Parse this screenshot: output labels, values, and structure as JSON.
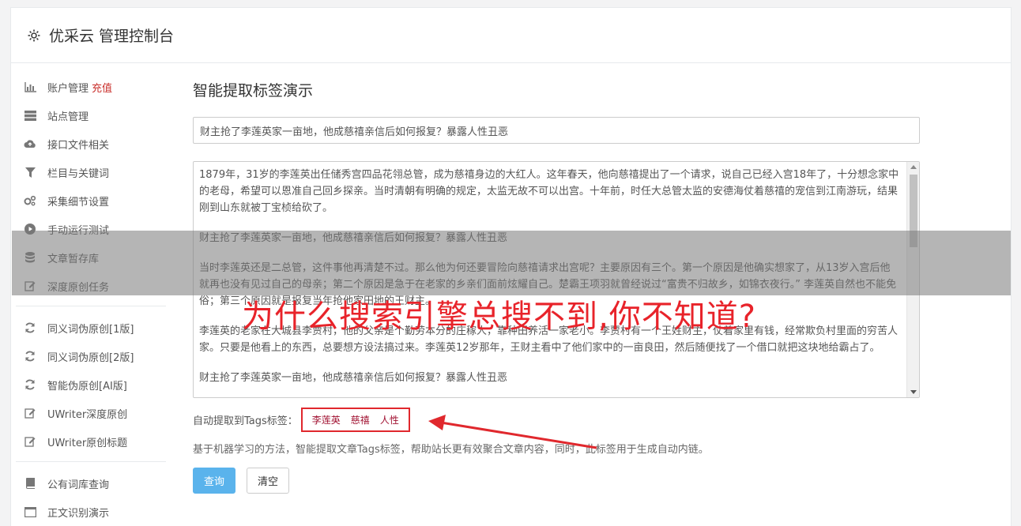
{
  "header": {
    "icon": "gear-icon",
    "title": "优采云 管理控制台"
  },
  "sidebar": {
    "groups": [
      [
        {
          "icon": "bar-chart-icon",
          "label": "账户管理",
          "badge": "充值"
        },
        {
          "icon": "server-icon",
          "label": "站点管理"
        },
        {
          "icon": "cloud-upload-icon",
          "label": "接口文件相关"
        },
        {
          "icon": "filter-icon",
          "label": "栏目与关键词"
        },
        {
          "icon": "gears-icon",
          "label": "采集细节设置"
        },
        {
          "icon": "play-circle-icon",
          "label": "手动运行测试"
        },
        {
          "icon": "database-icon",
          "label": "文章暂存库"
        },
        {
          "icon": "edit-icon",
          "label": "深度原创任务"
        }
      ],
      [
        {
          "icon": "refresh-icon",
          "label": "同义词伪原创[1版]"
        },
        {
          "icon": "refresh-icon",
          "label": "同义词伪原创[2版]"
        },
        {
          "icon": "refresh-icon",
          "label": "智能伪原创[AI版]"
        },
        {
          "icon": "edit-icon",
          "label": "UWriter深度原创"
        },
        {
          "icon": "edit-icon",
          "label": "UWriter原创标题"
        }
      ],
      [
        {
          "icon": "book-icon",
          "label": "公有词库查询"
        },
        {
          "icon": "window-icon",
          "label": "正文识别演示"
        }
      ]
    ]
  },
  "main": {
    "heading": "智能提取标签演示",
    "title_value": "财主抢了李莲英家一亩地，他成慈禧亲信后如何报复？暴露人性丑恶",
    "paragraphs": [
      "1879年，31岁的李莲英出任储秀宫四品花翎总管，成为慈禧身边的大红人。这年春天，他向慈禧提出了一个请求，说自己已经入宫18年了，十分想念家中的老母，希望可以恩准自己回乡探亲。当时清朝有明确的规定，太监无故不可以出宫。十年前，时任大总管太监的安德海仗着慈禧的宠信到江南游玩，结果刚到山东就被丁宝桢给砍了。",
      "财主抢了李莲英家一亩地，他成慈禧亲信后如何报复？暴露人性丑恶",
      "当时李莲英还是二总管，这件事他再清楚不过。那么他为何还要冒险向慈禧请求出宫呢？主要原因有三个。第一个原因是他确实想家了，从13岁入宫后他就再也没有见过自己的母亲；第二个原因是急于在老家的乡亲们面前炫耀自己。楚霸王项羽就曾经说过“富贵不归故乡，如锦衣夜行。” 李莲英自然也不能免俗；第三个原因就是报复当年抢他家田地的王财主。",
      "李莲英的老家在大城县李贾村，他的父亲是个勤劳本分的庄稼人，靠种田养活一家老小。李贾村有一个王姓财主，仗着家里有钱，经常欺负村里面的穷苦人家。只要是他看上的东西，总要想方设法搞过来。李莲英12岁那年，王财主看中了他们家中的一亩良田，然后随便找了一个借口就把这块地给霸占了。",
      "财主抢了李莲英家一亩地，他成慈禧亲信后如何报复？暴露人性丑恶"
    ],
    "tags_label": "自动提取到Tags标签：",
    "tags": [
      "李莲英",
      "慈禧",
      "人性"
    ],
    "hint": "基于机器学习的方法，智能提取文章Tags标签，帮助站长更有效聚合文章内容，同时，此标签用于生成自动内链。",
    "query_button": "查询",
    "clear_button": "清空"
  },
  "overlay": {
    "text": "为什么搜索引擎总搜不到,你不知道?",
    "color": "#e8232a"
  }
}
